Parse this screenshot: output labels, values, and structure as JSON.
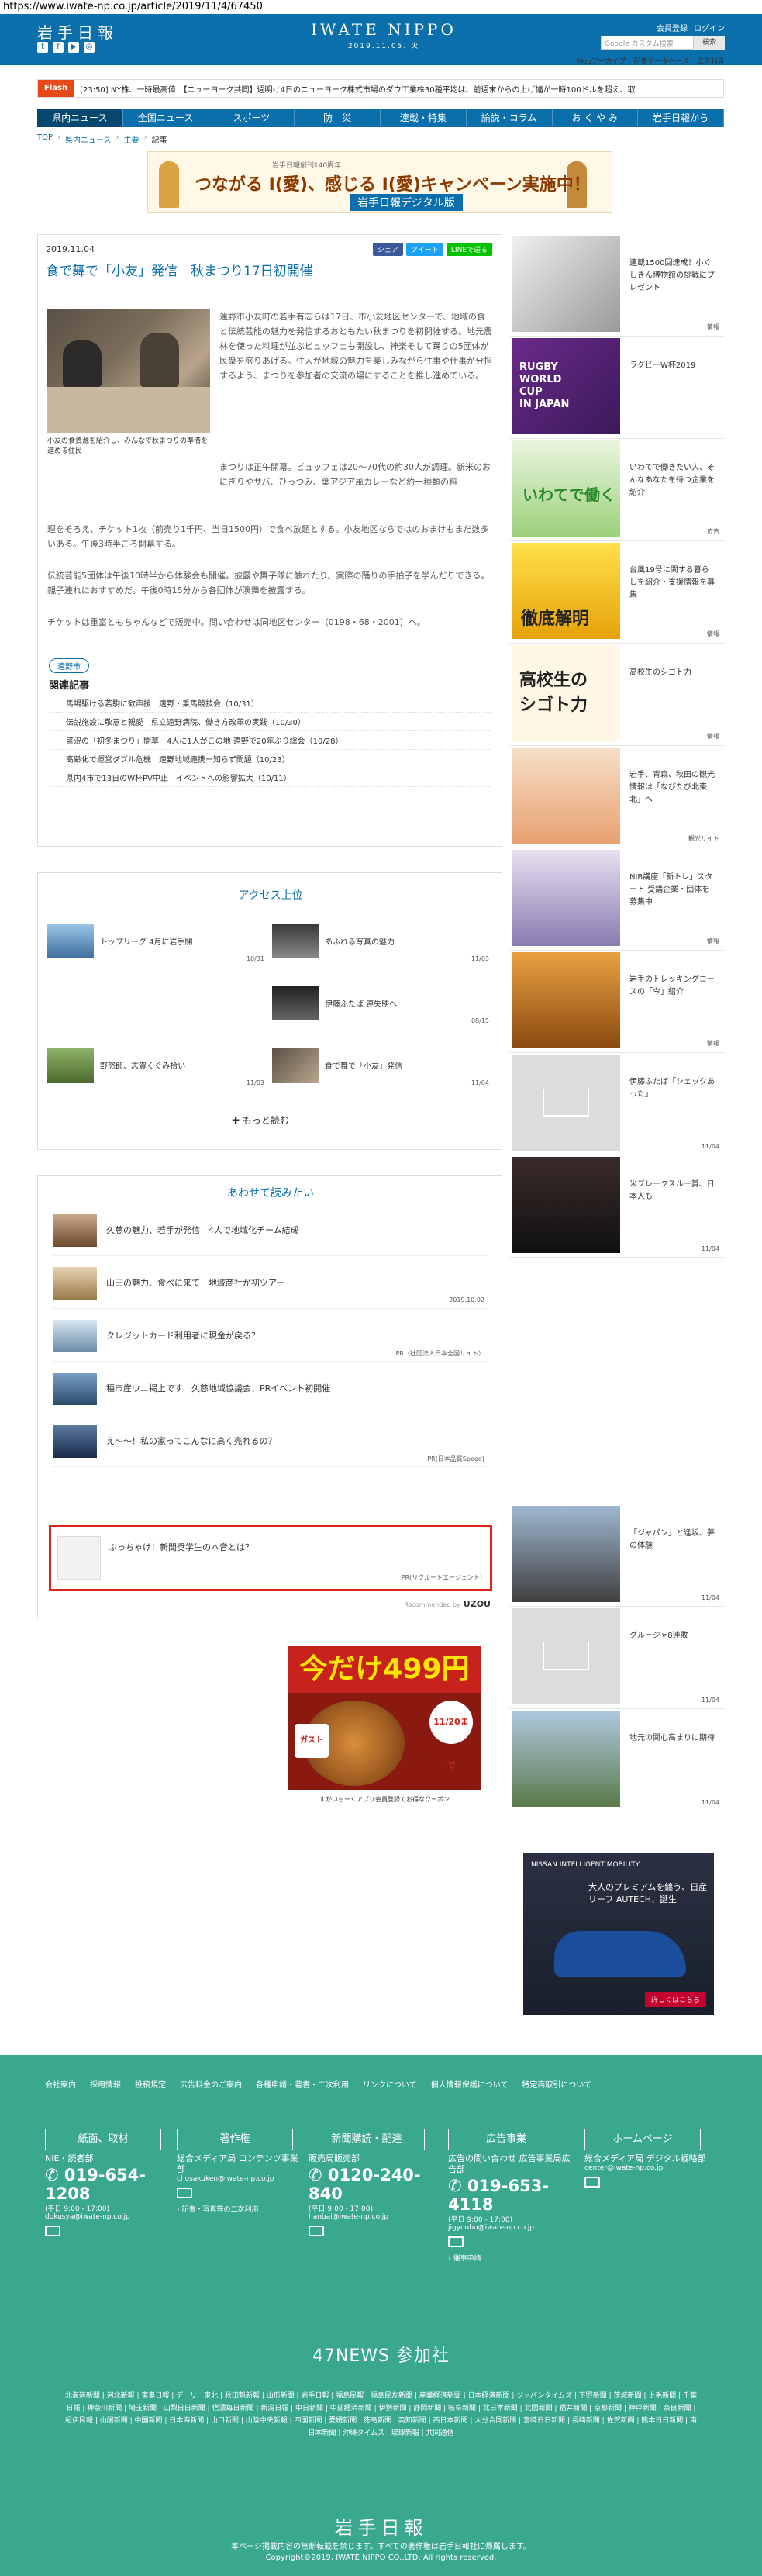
{
  "url": "https://www.iwate-np.co.jp/article/2019/11/4/67450",
  "header": {
    "logo_left": "岩手日報",
    "logo_center": "IWATE NIPPO",
    "date": "2019.11.05. 火",
    "links": [
      "会員登録",
      "ログイン"
    ],
    "search_placeholder": "Google カスタム検索",
    "search_button": "検索",
    "sub_links": [
      "Webアーカイブ",
      "記事データベース",
      "広告料金"
    ]
  },
  "ticker": {
    "label": "Flash",
    "text": "[23:50] NY株、一時最高値　【ニューヨーク共同】週明け4日のニューヨーク株式市場のダウ工業株30種平均は、前週末からの上げ幅が一時100ドルを超え、取"
  },
  "nav": [
    "県内ニュース",
    "全国ニュース",
    "スポーツ",
    "防　災",
    "連載・特集",
    "論説・コラム",
    "お  く  や  み",
    "岩手日報から"
  ],
  "breadcrumb": [
    "TOP",
    "県内ニュース",
    "主要",
    "記事"
  ],
  "banner": {
    "top": "岩手日報創刊140周年",
    "main": "つながる I(愛)、感じる I(愛)キャンペーン実施中！",
    "sub": "岩手日報デジタル版"
  },
  "article": {
    "date": "2019.11.04",
    "share": [
      "シェア",
      "ツイート",
      "LINEで送る"
    ],
    "title": "食で舞で「小友」発信　秋まつり17日初開催",
    "photo_caption": "小友の食資源を紹介し、みんなで秋まつりの準備を進める住民",
    "body_right": "遠野市小友町の若手有志らは17日、市小友地区センターで、地域の食と伝統芸能の魅力を発信するおともたい秋まつりを初開催する。地元農林を使った料理が並ぶビュッフェも開設し、神楽そして踊りの5団体が民衆を盛りあげる。住人が地域の魅力を楽しみながら住事や仕事が分担するよう、まつりを参加者の交流の場にすることを推し進めている。",
    "body_right2": "まつりは正午開幕。ビュッフェは20〜70代の約30人が調理。新米のおにぎりやサバ、ひっつみ、葉アジア風カレーなど約十種類の料",
    "body_full": "理をそろえ、チケット1枚（前売り1千円、当日1500円）で食べ放題とする。小友地区ならではのおまけもまだ数多いある。午後3時半ごろ開幕する。",
    "body_full2": "伝統芸能5団体は午後10時半から体験会も開催。披露や舞子隊に触れたり、実際の踊りの手拍子を学んだりできる。親子連れにおすすめだ。午後0時15分から各団体が演舞を披露する。",
    "body_full3": "チケットは重富ともちゃんなどで販売中。問い合わせは同地区センター（0198・68・2001）へ。",
    "tag": "遠野市",
    "related_head": "関連記事",
    "related": [
      "馬場駆ける若駒に歓声援　遠野・乗馬競技会（10/31）",
      "伝説施設に敬意と親愛　県立遠野病院、働き方改革の実践（10/30）",
      "盛況の「初冬まつり」開幕　4人に1人がこの地 遠野で20年ぶり総会（10/28）",
      "高齢化で運営ダブル危機　遠野地域連携ー知らず問題（10/23）",
      "県内4市で13日のW杯PV中止　イベントへの影響拡大（10/11）"
    ]
  },
  "ranking": {
    "title": "アクセス上位",
    "items": [
      {
        "title": "トップリーグ 4月に岩手開",
        "date": "10/31"
      },
      {
        "title": "あふれる写真の魅力",
        "date": "11/03"
      },
      {
        "title": "伊藤ふたば 連失勝へ",
        "date": "08/15"
      },
      {
        "title": "野怒郎、志賀くぐみ拾い",
        "date": "11/03"
      },
      {
        "title": "食で舞で「小友」発信",
        "date": "11/04"
      }
    ],
    "more": "もっと読む"
  },
  "recommend": {
    "title": "あわせて読みたい",
    "items": [
      {
        "title": "久慈の魅力、若手が発信　4人で地域化チーム結成",
        "meta": ""
      },
      {
        "title": "山田の魅力、食べに来て　地域商社が初ツアー",
        "meta": "2019.10.02"
      },
      {
        "title": "クレジットカード利用者に現金が戻る？",
        "meta": "PR（社団法人日本全国サイト）"
      },
      {
        "title": "種市産ウニ掲上です　久慈地域協議会、PRイベント初開催",
        "meta": ""
      },
      {
        "title": "え〜〜！私の家ってこんなに高く売れるの？",
        "meta": "PR(日本品質Speed)"
      },
      {
        "title": "ぶっちゃけ！新聞奨学生の本音とは？",
        "meta": "PR(リクルートエージェント)"
      }
    ],
    "powered": "Recommended by",
    "powered_brand": "UZOU"
  },
  "ad": {
    "headline": "今だけ499円",
    "brand": "ガスト",
    "date": "11/20まで",
    "bottom": "すかいらーくアプリ会員登録でお得なクーポン"
  },
  "sidebar": [
    {
      "title": "連載1500回達成！小ぐしきん博物館の挑戦にプレゼント",
      "tag": "情報"
    },
    {
      "title": "ラグビーW杯2019",
      "tag": ""
    },
    {
      "title": "いわてで働きたい人、そんなあなたを待つ企業を紹介",
      "tag": "広告"
    },
    {
      "title": "台風19号に関する暮らしを紹介・支援情報を募集",
      "tag": "情報"
    },
    {
      "title": "高校生のシゴト力",
      "tag": "情報"
    },
    {
      "title": "岩手、青森、秋田の観光情報は「なびたび北東北」へ",
      "tag": "観光サイト"
    },
    {
      "title": "NIB講座「新トレ」スタート 受講企業・団体を募集中",
      "tag": "情報"
    },
    {
      "title": "岩手のトレッキングコースの「今」紹介",
      "tag": "情報"
    },
    {
      "title": "伊藤ふたば「シェックあった」",
      "tag": "11/04"
    },
    {
      "title": "米ブレークスルー賞、日本人も",
      "tag": "11/04"
    },
    {
      "title": "「ジャパン」と逢坂、夢の体験",
      "tag": "11/04"
    },
    {
      "title": "グルージャ8連敗",
      "tag": "11/04"
    },
    {
      "title": "地元の関心高まりに期待",
      "tag": "11/04"
    }
  ],
  "nissan_ad": {
    "brand": "NISSAN INTELLIGENT MOBILITY",
    "copy": "大人のプレミアムを纏う、日産リーフ AUTECH、誕生",
    "button": "詳しくはこちら"
  },
  "footer": {
    "links": [
      "会社案内",
      "採用情報",
      "投稿規定",
      "広告料金のご案内",
      "各種申請・著書・二次利用",
      "リンクについて",
      "個人情報保護について",
      "特定商取引について"
    ],
    "cols": [
      {
        "head": "紙面、取材",
        "label": "NIE・読者部",
        "phone": "019-654-1208",
        "hours": "(平日 9:00 - 17:00)",
        "email": "dokusya@iwate-np.co.jp",
        "link": ""
      },
      {
        "head": "著作権",
        "label": "総合メディア局 コンテンツ事業部",
        "phone": "",
        "hours": "",
        "email": "chosakuken@iwate-np.co.jp",
        "link": "記事・写真等の二次利用"
      },
      {
        "head": "新聞購読・配達",
        "label": "販売局販売部",
        "phone": "0120-240-840",
        "hours": "(平日 9:00 - 17:00)",
        "email": "hanbai@iwate-np.co.jp",
        "link": ""
      },
      {
        "head": "広告事業",
        "label": "広告の問い合わせ 広告事業局広告部",
        "phone": "019-653-4118",
        "hours": "(平日 9:00 - 17:00)",
        "email": "jigyoubu@iwate-np.co.jp",
        "link": "催事申請"
      },
      {
        "head": "ホームページ",
        "label": "総合メディア局 デジタル戦略部",
        "phone": "",
        "hours": "",
        "email": "center@iwate-np.co.jp",
        "link": ""
      }
    ],
    "f47": "47NEWS 参加社",
    "papers": "北海道新聞 | 河北新報 | 東奥日報 | デーリー東北 | 秋田魁新報 | 山形新聞 | 岩手日報 | 福島民報 | 福島民友新聞 | 産業経済新聞 | 日本経済新聞 | ジャパンタイムズ | 下野新聞 | 茨城新聞 | 上毛新聞 | 千葉日報 | 神奈川新聞 | 埼玉新聞 | 山梨日日新聞 | 信濃毎日新聞 | 新潟日報 | 中日新聞 | 中部経済新聞 | 伊勢新聞 | 静岡新聞 | 岐阜新聞 | 北日本新聞 | 北國新聞 | 福井新聞 | 京都新聞 | 神戸新聞 | 奈良新聞 | 紀伊民報 | 山陽新聞 | 中国新聞 | 日本海新聞 | 山口新聞 | 山陰中央新報 | 四国新聞 | 愛媛新聞 | 徳島新聞 | 高知新聞 | 西日本新聞 | 大分合同新聞 | 宮崎日日新聞 | 長崎新聞 | 佐賀新聞 | 熊本日日新聞 | 南日本新聞 | 沖縄タイムス | 琉球新報 | 共同通信",
    "logo": "岩手日報",
    "note": "本ページ掲載内容の無断転載を禁じます。すべての著作権は岩手日報社に帰属します。",
    "copyright": "Copyright©2019, IWATE NIPPO CO.,LTD. All rights reserved."
  }
}
